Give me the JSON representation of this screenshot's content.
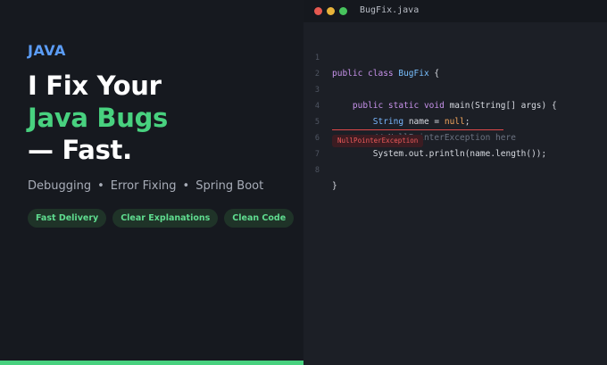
{
  "left": {
    "language_tag": "JAVA",
    "headline": {
      "line1": "I Fix Your",
      "line2": "Java Bugs",
      "line3": "— Fast."
    },
    "services": [
      "Debugging",
      "Error Fixing",
      "Spring Boot"
    ],
    "separator": "•",
    "pills": [
      "Fast Delivery",
      "Clear Explanations",
      "Clean Code"
    ]
  },
  "editor": {
    "filename": "BugFix.java",
    "line_numbers": [
      "1",
      "2",
      "3",
      "4",
      "5",
      "6",
      "7",
      "8"
    ],
    "code": {
      "l1_kw": "public class ",
      "l1_cls": "BugFix",
      "l1_rest": " {",
      "l3_kw": "public static void ",
      "l3_rest": "main(String[] args) {",
      "l4_type": "String",
      "l4_mid": " name = ",
      "l4_val": "null",
      "l4_end": ";",
      "l5_comment": "// NullPointerException here",
      "l6_code": "System.out.println(name.length());",
      "l8_code": "}"
    },
    "error_label": "NullPointerException"
  },
  "colors": {
    "accent_green": "#48d17f",
    "accent_blue": "#5b9cf5",
    "error_red": "#ef5a5a",
    "background": "#16191f"
  }
}
